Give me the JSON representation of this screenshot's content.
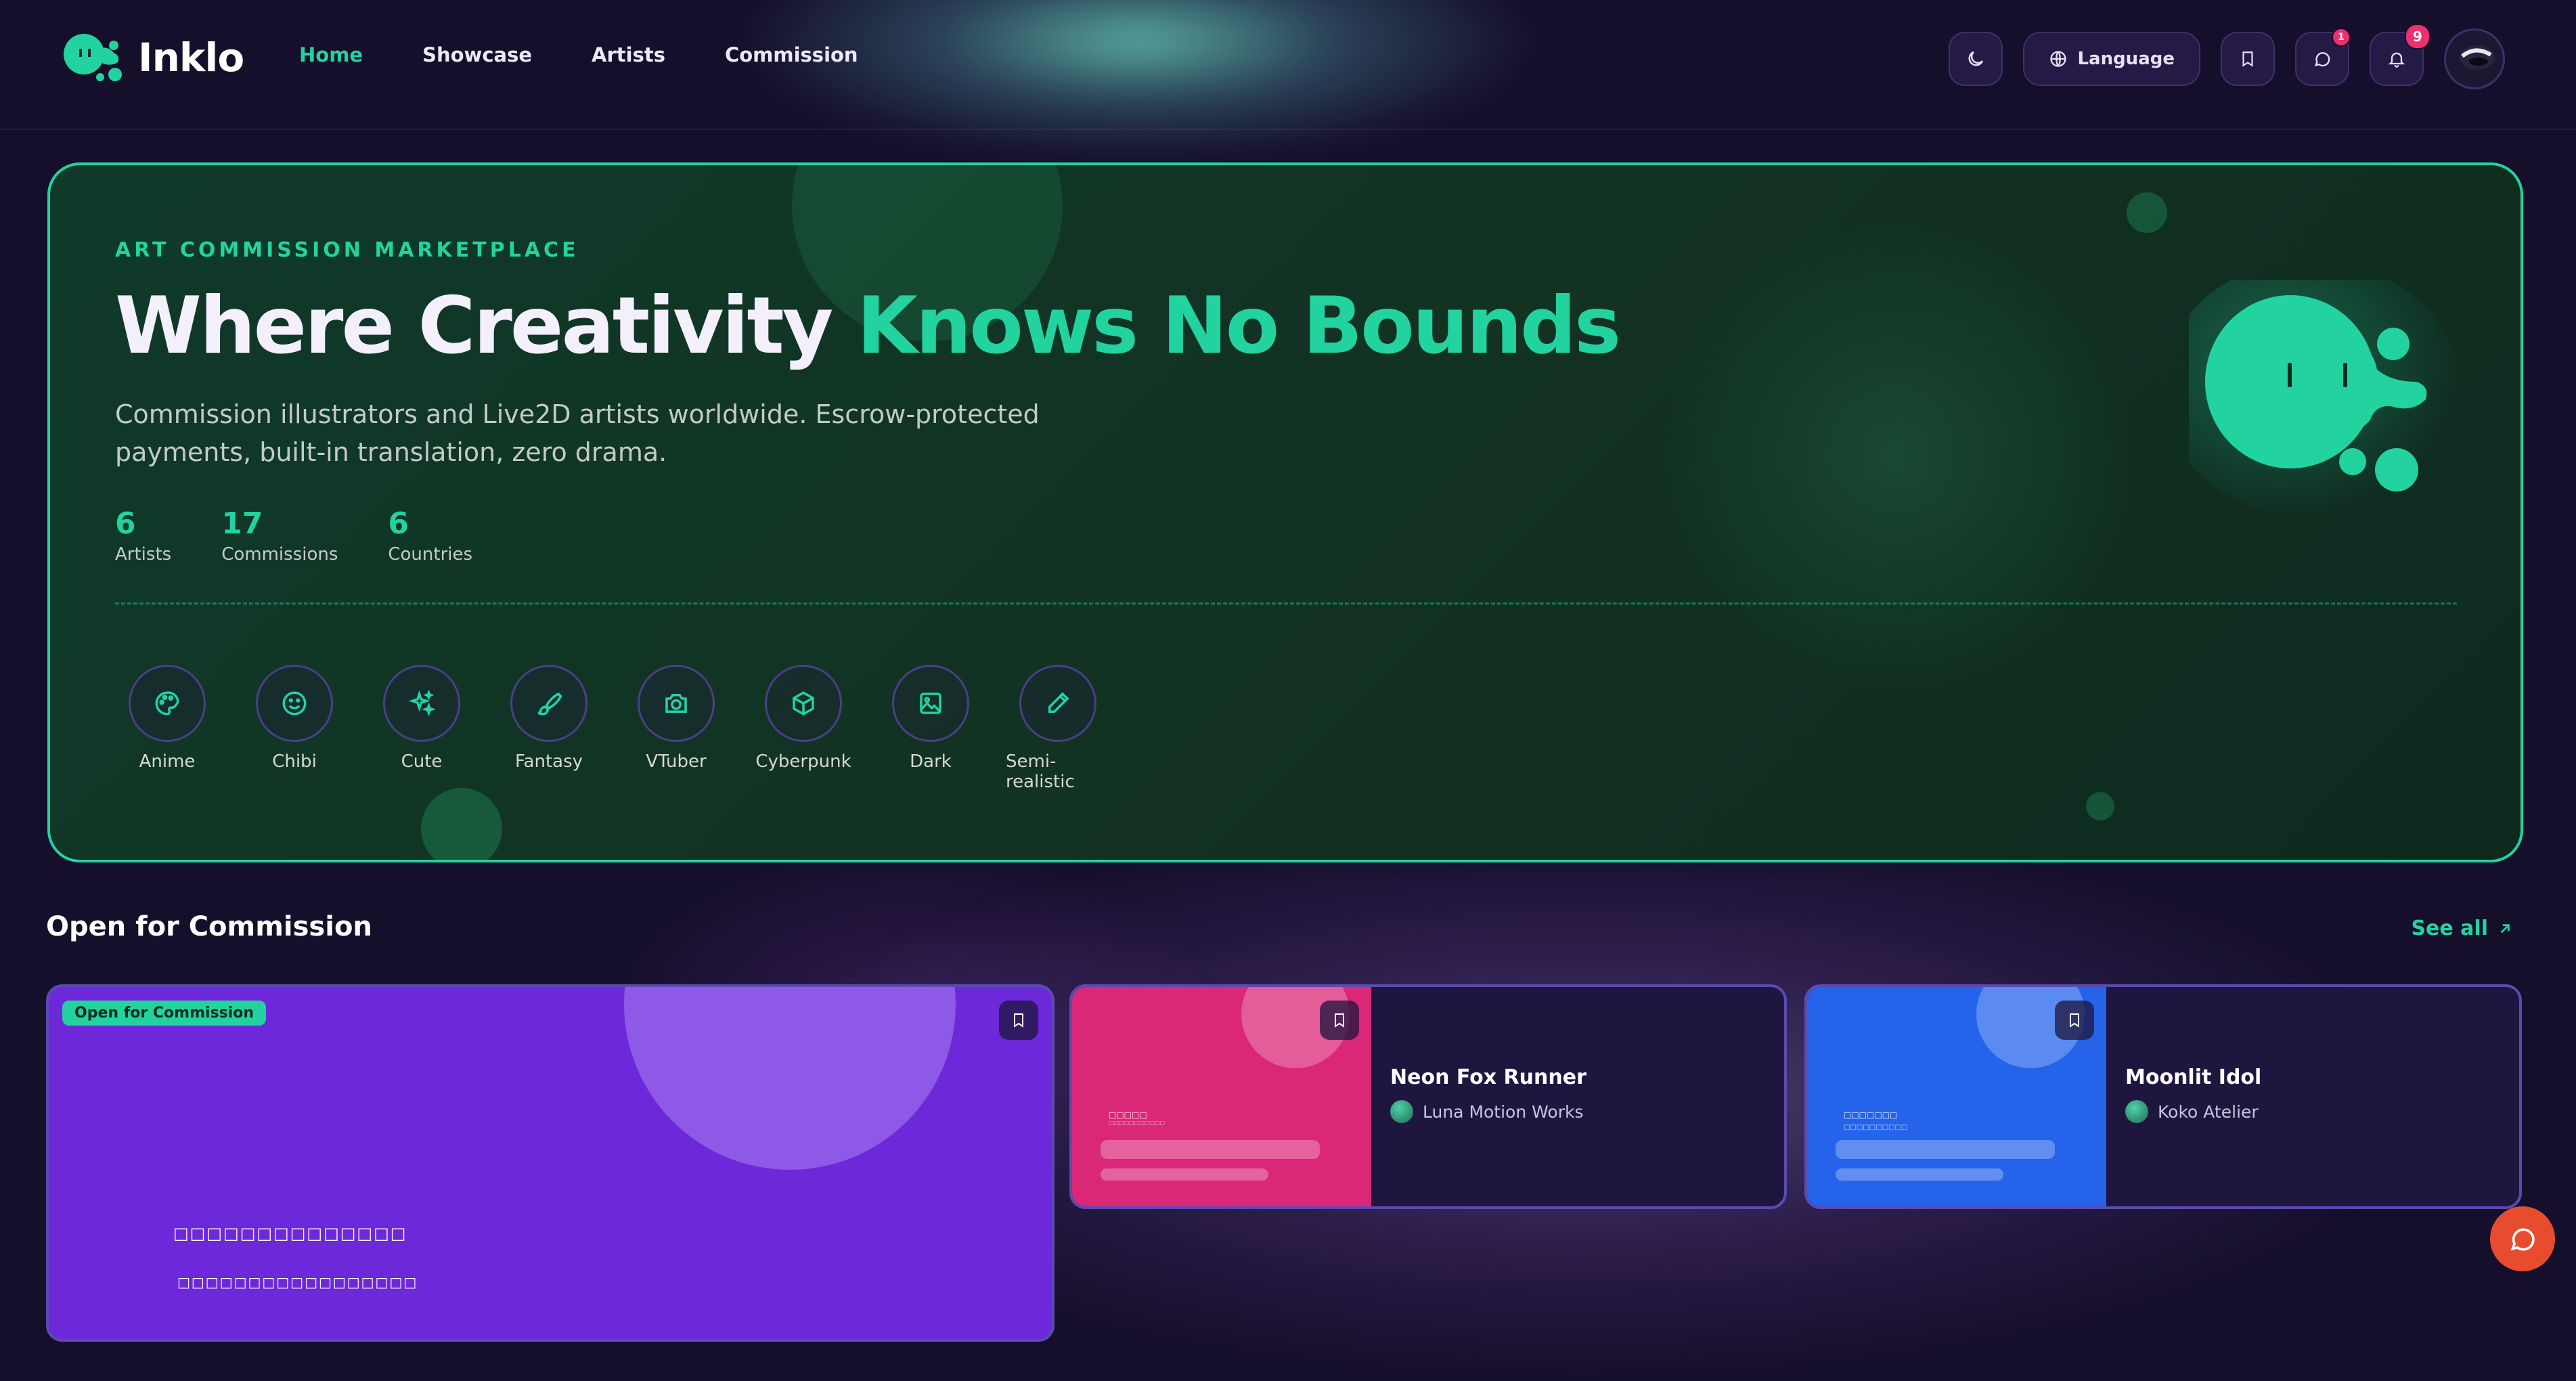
{
  "app": {
    "name": "Inklo"
  },
  "nav": {
    "links": [
      {
        "label": "Home",
        "active": true
      },
      {
        "label": "Showcase",
        "active": false
      },
      {
        "label": "Artists",
        "active": false
      },
      {
        "label": "Commission",
        "active": false
      }
    ],
    "language_label": "Language",
    "messages_badge": "1",
    "notifications_badge": "9"
  },
  "hero": {
    "eyebrow": "ART COMMISSION MARKETPLACE",
    "title_main": "Where Creativity ",
    "title_accent": "Knows No Bounds",
    "subtitle": "Commission illustrators and Live2D artists worldwide. Escrow-protected payments, built-in translation, zero drama.",
    "stats": [
      {
        "value": "6",
        "label": "Artists"
      },
      {
        "value": "17",
        "label": "Commissions"
      },
      {
        "value": "6",
        "label": "Countries"
      }
    ],
    "categories": [
      {
        "label": "Anime",
        "icon": "palette-icon"
      },
      {
        "label": "Chibi",
        "icon": "smile-icon"
      },
      {
        "label": "Cute",
        "icon": "sparkles-icon"
      },
      {
        "label": "Fantasy",
        "icon": "brush-icon"
      },
      {
        "label": "VTuber",
        "icon": "camera-icon"
      },
      {
        "label": "Cyberpunk",
        "icon": "cube-icon"
      },
      {
        "label": "Dark",
        "icon": "image-icon"
      },
      {
        "label": "Semi-realistic",
        "icon": "pencil-icon"
      }
    ]
  },
  "section": {
    "title": "Open for Commission",
    "see_all": "See all"
  },
  "cards": [
    {
      "pill": "Open for Commission",
      "garble_1": "□□□□□□□□□□□□□□",
      "garble_2": "□□□□□□□□□□□□□□□□□",
      "color": "#6d28d9"
    },
    {
      "title": "Neon Fox Runner",
      "artist": "Luna Motion Works",
      "thumb_color": "#db2777",
      "thumb_text_1": "□□□□□",
      "thumb_text_2": "□□□□□□□□□□□"
    },
    {
      "title": "Moonlit Idol",
      "artist": "Koko Atelier",
      "thumb_color": "#2563eb",
      "thumb_text_1": "□□□□□□□",
      "thumb_text_2": "□□□□□□□□□□"
    }
  ],
  "colors": {
    "accent": "#22d3a0",
    "badge": "#ec2f6f",
    "fab": "#e74c2e"
  }
}
